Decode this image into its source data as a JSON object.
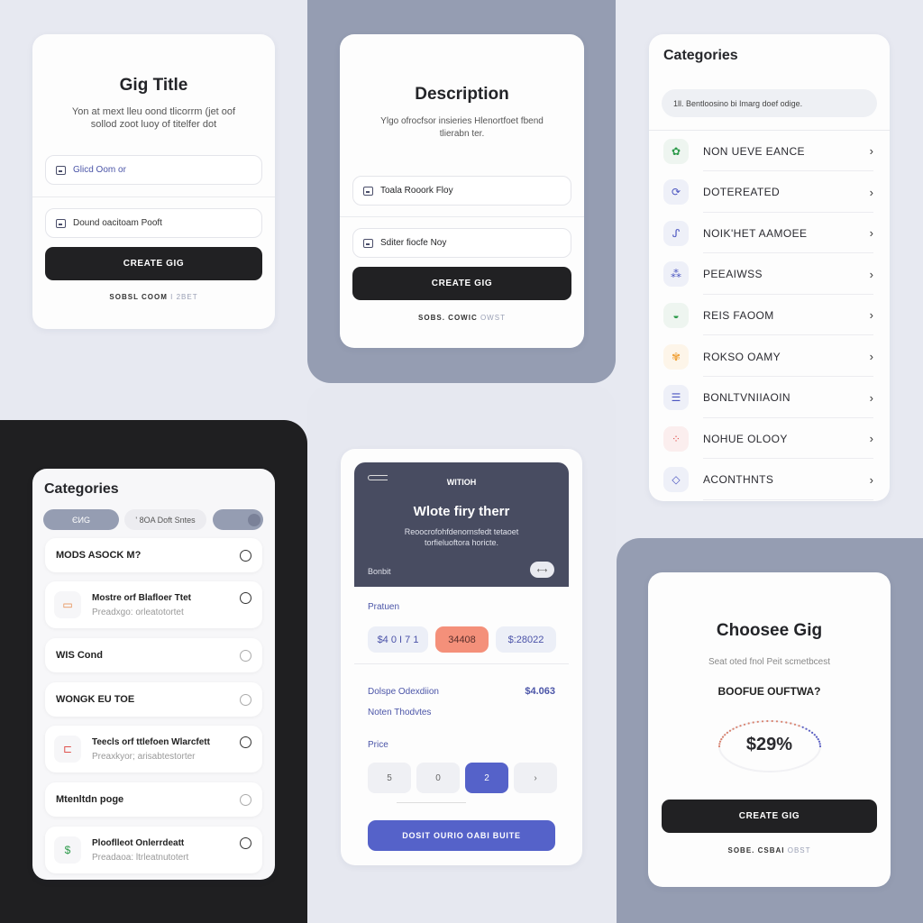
{
  "colors": {
    "background": "#e7e9f1",
    "slate_tile": "#959db2",
    "dark_tile": "#1f1f21",
    "primary_dark": "#212123",
    "accent_blue": "#5562c9",
    "accent_orange": "#f4907a",
    "hero_bg": "#484c61"
  },
  "gig_title_card": {
    "title": "Gig Title",
    "subtitle": "Yon at mext lleu oond tlicorrm (jet oof sollod zoot luoy of titelfer dot",
    "field1": {
      "icon": "image-icon",
      "value": "Glicd Oom or"
    },
    "field2": {
      "icon": "calendar-icon",
      "value": "Dound oacitoam Pooft"
    },
    "button": "CREATE GIG",
    "footer_main": "SOBSL COOM",
    "footer_muted": "I 2BET"
  },
  "description_card": {
    "title": "Description",
    "subtitle": "Ylgo ofrocfsor insieries Hlenortfoet fbend tlierabn ter.",
    "field1": {
      "icon": "image-icon",
      "value": "Toala Rooork Floy"
    },
    "field2": {
      "icon": "note-icon",
      "value": "Sditer fiocfe Noy"
    },
    "button": "CREATE GIG",
    "footer_main": "SOBS. COWIC",
    "footer_muted": "OWST"
  },
  "categories_right": {
    "title": "Categories",
    "search_placeholder": "1ll. Bentloosino bi Imarg doef odige.",
    "items": [
      {
        "label": "NON UEVE EANCE",
        "icon": "leaf-icon",
        "glyph": "✿",
        "fg": "#2c9a4a",
        "bg": "#eef5f0"
      },
      {
        "label": "DOTEREATED",
        "icon": "refresh-icon",
        "glyph": "⟳",
        "fg": "#4b55c0",
        "bg": "#eef0f8"
      },
      {
        "label": "NOIK'HET AAMOEE",
        "icon": "route-icon",
        "glyph": "ᔑ",
        "fg": "#4b55c0",
        "bg": "#eef0f8"
      },
      {
        "label": "PEEAIWSS",
        "icon": "network-icon",
        "glyph": "⁂",
        "fg": "#4b55c0",
        "bg": "#eef0f8"
      },
      {
        "label": "REIS FAOOM",
        "icon": "bowl-icon",
        "glyph": "◒",
        "fg": "#2c9a4a",
        "bg": "#eef5f0"
      },
      {
        "label": "ROKSO OAMY",
        "icon": "puzzle-icon",
        "glyph": "✾",
        "fg": "#f0a33c",
        "bg": "#fdf5e9"
      },
      {
        "label": "BONLTVNIIAOIN",
        "icon": "list-icon",
        "glyph": "☰",
        "fg": "#4b55c0",
        "bg": "#eef0f8"
      },
      {
        "label": "NOHUE OLOOY",
        "icon": "molecule-icon",
        "glyph": "⁘",
        "fg": "#e0524e",
        "bg": "#fbeeee"
      },
      {
        "label": "ACONTHNTS",
        "icon": "diamond-icon",
        "glyph": "◇",
        "fg": "#4b55c0",
        "bg": "#eef0f8"
      }
    ]
  },
  "categories_left": {
    "title": "Categories",
    "chips": [
      {
        "label": "ЄИG",
        "active": true
      },
      {
        "label": "' 8OA Doft Sntes",
        "active": false
      },
      {
        "label": "",
        "active": true,
        "toggle": true
      }
    ],
    "options": [
      {
        "title": "MODS ASOCK M?",
        "subtitle": null,
        "icon": null,
        "selected": true
      },
      {
        "title": "Mostre orf Blafloer Ttet",
        "subtitle": "Preadxgo: orleatotortet",
        "icon": "laptop-icon",
        "glyph": "▭",
        "fg": "#e58a4a",
        "selected": true
      },
      {
        "title": "WIS Cond",
        "subtitle": null,
        "icon": null,
        "selected": false
      },
      {
        "title": "WONGK EU TOE",
        "subtitle": null,
        "icon": null,
        "selected": false
      },
      {
        "title": "Teecls orf ttlefoen Wlarcfett",
        "subtitle": "Preaxkyor; arisabtestorter",
        "icon": "cart-icon",
        "glyph": "⊏",
        "fg": "#e0524e",
        "selected": true
      },
      {
        "title": "Mtenltdn poge",
        "subtitle": null,
        "icon": null,
        "selected": false
      },
      {
        "title": "Plooflleot Onlerrdeatt",
        "subtitle": "Preadaoa: ltrleatnutotert",
        "icon": "dollar-icon",
        "glyph": "$",
        "fg": "#2c9a4a",
        "selected": true
      }
    ]
  },
  "pricing_card": {
    "hero": {
      "nav_title": "WITIOH",
      "title": "Wlote firy therr",
      "subtitle": "Reoocrofohfdenornsfedt tetaoet torfieluoftora horicte.",
      "label": "Bonbit",
      "pill": "⟷"
    },
    "packages_label": "Pratuen",
    "packages": [
      {
        "label": "$4 0 I 7 1",
        "selected": false
      },
      {
        "label": "34408",
        "selected": true
      },
      {
        "label": "$:28022",
        "selected": false
      }
    ],
    "detail_label": "Dolspe Odexdiion",
    "detail_value": "$4.063",
    "detail_sub": "Noten Thodvtes",
    "price_label": "Price",
    "pager": [
      {
        "label": "5",
        "active": false
      },
      {
        "label": "0",
        "active": false
      },
      {
        "label": "2",
        "active": true
      },
      {
        "label": "›",
        "active": false
      }
    ],
    "button": "DOSIT OURIO OABI BUITE"
  },
  "choose_card": {
    "title": "Choosee Gig",
    "subtitle": "Seat oted fnol Peit scmetbcest",
    "question": "BOOFUE OUFTWA?",
    "gauge_value_text": "$29%",
    "gauge_percent": 29,
    "button": "CREATE GIG",
    "footer_main": "SOBE. CSBAI",
    "footer_muted": "OBST"
  }
}
